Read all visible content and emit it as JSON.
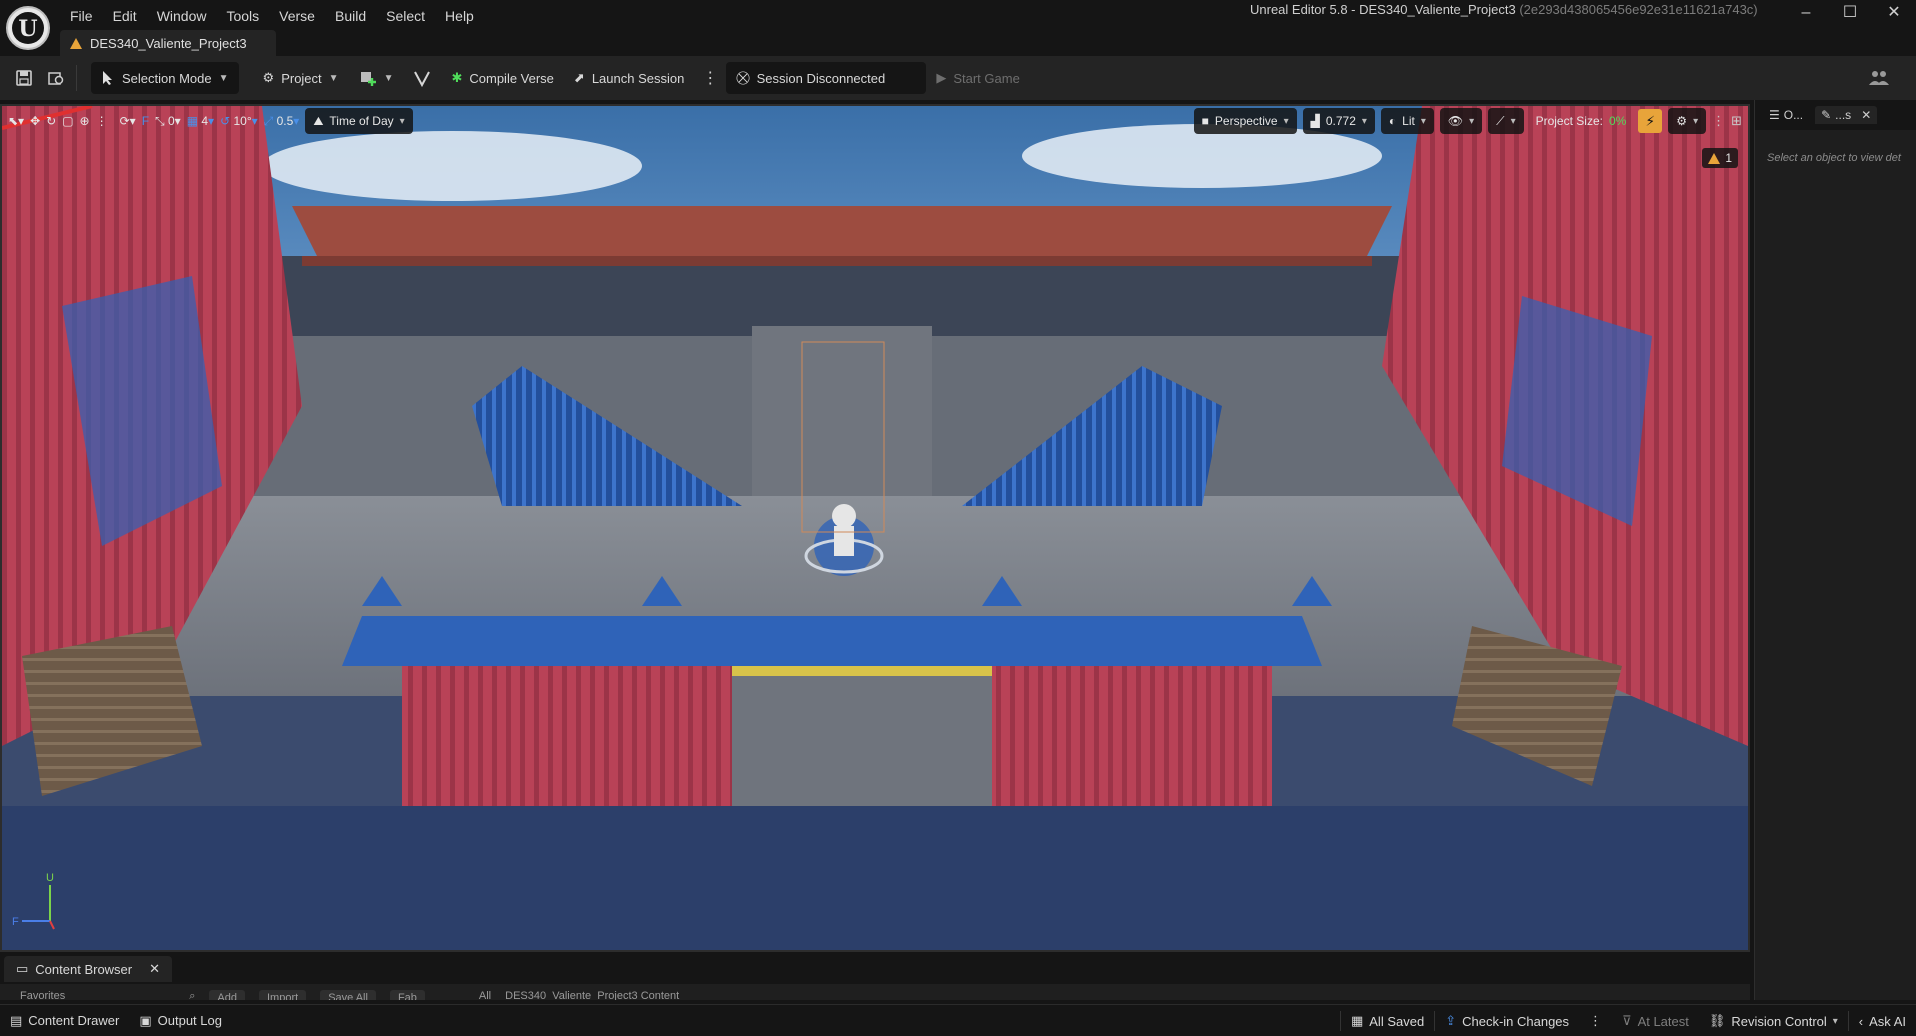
{
  "app": {
    "logo_letter": "U",
    "window_title": "Unreal Editor 5.8 - DES340_Valiente_Project3",
    "window_hash": "(2e293d438065456e92e31e11621a743c)",
    "project_tab": "DES340_Valiente_Project3",
    "win_controls": {
      "minimize": "–",
      "maximize": "☐",
      "close": "✕"
    }
  },
  "menu": [
    "File",
    "Edit",
    "Window",
    "Tools",
    "Verse",
    "Build",
    "Select",
    "Help"
  ],
  "toolbar": {
    "selection_mode": "Selection Mode",
    "project": "Project",
    "compile_verse": "Compile Verse",
    "launch_session": "Launch Session",
    "session_status": "Session Disconnected",
    "start_game": "Start Game"
  },
  "viewport_toolbar": {
    "snap_rotate_value": "0",
    "grid_value": "4",
    "rotation_snap": "10°",
    "scale_snap": "0.5",
    "time_of_day": "Time of Day",
    "perspective": "Perspective",
    "camera_speed": "0.772",
    "lit": "Lit",
    "project_size_label": "Project Size:",
    "project_size_value": "0%",
    "warning_count": "1"
  },
  "axis": {
    "up": "U",
    "forward": "F"
  },
  "right_panel": {
    "tab_outliner": "O...",
    "tab_details": "...s",
    "hint": "Select an object to view det"
  },
  "content_browser": {
    "tab_label": "Content Browser",
    "favorites": "Favorites",
    "add": "Add",
    "import": "Import",
    "save_all": "Save All",
    "fab": "Fab",
    "path_all": "All",
    "path_content": "DES340_Valiente_Project3 Content"
  },
  "statusbar": {
    "content_drawer": "Content Drawer",
    "output_log": "Output Log",
    "all_saved": "All Saved",
    "check_in": "Check-in Changes",
    "at_latest": "At Latest",
    "revision_control": "Revision Control",
    "ask_ai": "Ask AI"
  },
  "colors": {
    "accent_orange": "#e8a43a",
    "project_size_green": "#4fdc5a",
    "container_red": "#b94257",
    "container_blue": "#2f63b8"
  }
}
